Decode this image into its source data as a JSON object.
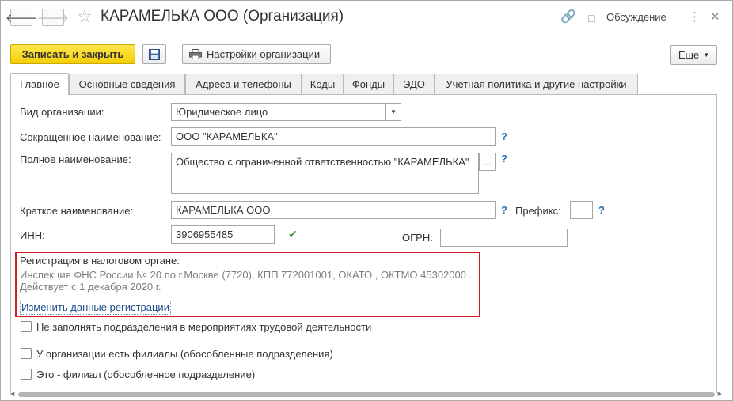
{
  "header": {
    "title": "КАРАМЕЛЬКА ООО (Организация)",
    "discuss_label": "Обсуждение",
    "back_icon": "arrow-left-icon",
    "forward_icon": "arrow-right-icon"
  },
  "toolbar": {
    "save_close_label": "Записать и закрыть",
    "settings_label": "Настройки организации",
    "more_label": "Еще"
  },
  "tabs": [
    {
      "label": "Главное"
    },
    {
      "label": "Основные сведения"
    },
    {
      "label": "Адреса и телефоны"
    },
    {
      "label": "Коды"
    },
    {
      "label": "Фонды"
    },
    {
      "label": "ЭДО"
    },
    {
      "label": "Учетная политика и другие настройки"
    }
  ],
  "form": {
    "org_type_label": "Вид организации:",
    "org_type_value": "Юридическое лицо",
    "short_name_label": "Сокращенное наименование:",
    "short_name_value": "ООО \"КАРАМЕЛЬКА\"",
    "full_name_label": "Полное наименование:",
    "full_name_value": "Общество с ограниченной ответственностью \"КАРАМЕЛЬКА\"",
    "brief_name_label": "Краткое наименование:",
    "brief_name_value": "КАРАМЕЛЬКА ООО",
    "prefix_label": "Префикс:",
    "prefix_value": "",
    "inn_label": "ИНН:",
    "inn_value": "3906955485",
    "ogrn_label": "ОГРН:",
    "ogrn_value": "",
    "help_mark": "?"
  },
  "registration": {
    "title": "Регистрация в налоговом органе:",
    "line1": "Инспекция ФНС России № 20 по г.Москве (7720), КПП 772001001, ОКАТО , ОКТМО 45302000  .",
    "line2": "Действует с 1 декабря 2020 г.",
    "link": "Изменить данные регистрации"
  },
  "checkboxes": [
    {
      "label": "Не заполнять подразделения в мероприятиях трудовой деятельности",
      "checked": false
    },
    {
      "label": "У организации есть филиалы (обособленные подразделения)",
      "checked": false
    },
    {
      "label": "Это - филиал (обособленное подразделение)",
      "checked": false
    }
  ],
  "colors": {
    "primary_button": "#f5cf06",
    "highlight_border": "#d41c24",
    "help_mark": "#2f6db5",
    "valid_check": "#3a9a3a"
  }
}
